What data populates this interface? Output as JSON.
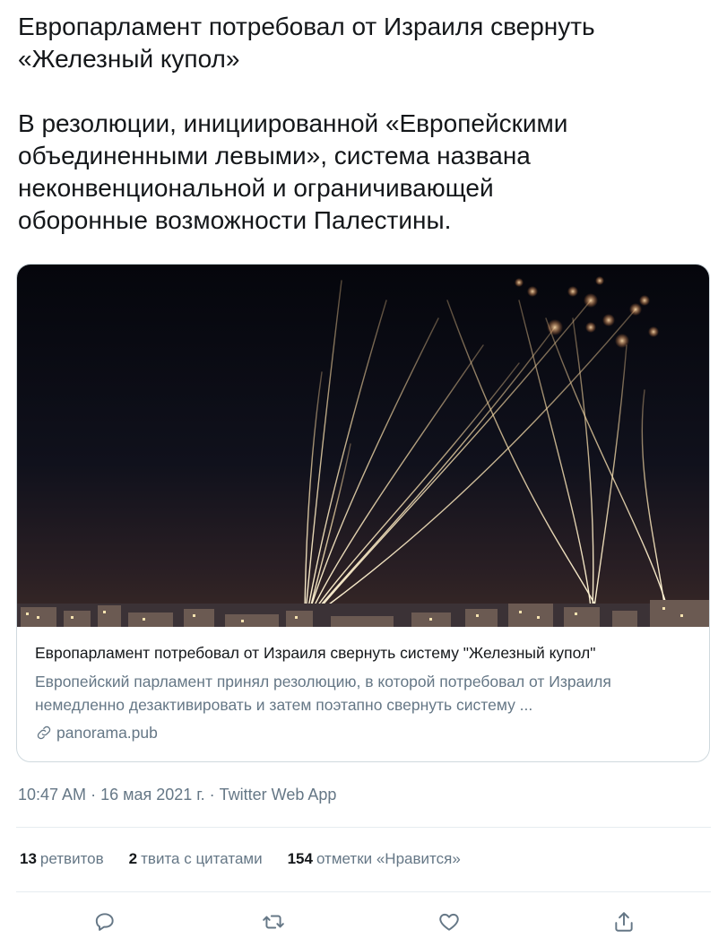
{
  "tweet": {
    "text": "Европарламент потребовал от Израиля свернуть\n«Железный купол»\n\nВ резолюции, инициированной «Европейскими\nобъединенными левыми», система названа\nнеконвенциональной и ограничивающей\nоборонные возможности Палестины."
  },
  "card": {
    "image_alt": "night-sky-interceptor-missiles-photo",
    "title": "Европарламент потребовал от Израиля свернуть систему \"Железный купол\"",
    "description": "Европейский парламент принял резолюцию, в которой потребовал от Израиля немедленно дезактивировать и затем поэтапно свернуть систему ...",
    "domain": "panorama.pub",
    "domain_icon": "link-icon"
  },
  "meta": {
    "time": "10:47 AM",
    "sep1": " · ",
    "date": "16 мая 2021 г.",
    "sep2": " · ",
    "source": "Twitter Web App"
  },
  "stats": {
    "retweets_count": "13",
    "retweets_label": "ретвитов",
    "quotes_count": "2",
    "quotes_label": "твита с цитатами",
    "likes_count": "154",
    "likes_label": "отметки «Нравится»"
  },
  "actions": {
    "icons": [
      "reply-icon",
      "retweet-icon",
      "like-icon",
      "share-icon"
    ]
  },
  "colors": {
    "text": "#14171a",
    "secondary": "#657786",
    "border": "#cfd9de",
    "divider": "#e6ecf0"
  }
}
